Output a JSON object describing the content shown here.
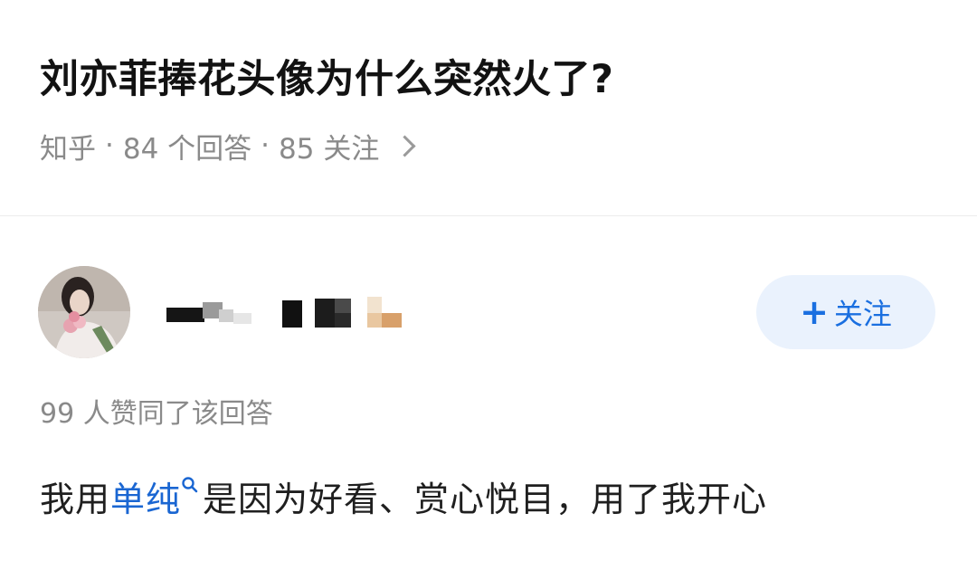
{
  "question": {
    "title": "刘亦菲捧花头像为什么突然火了?",
    "source": "知乎",
    "sep1": "·",
    "answers_count": "84 个回答",
    "sep2": "·",
    "followers_count": "85 关注"
  },
  "answer": {
    "follow_plus": "+",
    "follow_label": "关注",
    "votes_text": "99 人赞同了该回答",
    "text_before": "我用",
    "keyword": "单纯",
    "text_after": "是因为好看、赏心悦目，用了我开心"
  },
  "colors": {
    "accent": "#1a6fe0",
    "follow_bg": "#eaf2fd",
    "meta_gray": "#8a8a8a",
    "keyword_blue": "#1a66d2"
  },
  "icons": {
    "meta_chevron": "chevron-right-icon",
    "keyword_search": "search-icon"
  }
}
